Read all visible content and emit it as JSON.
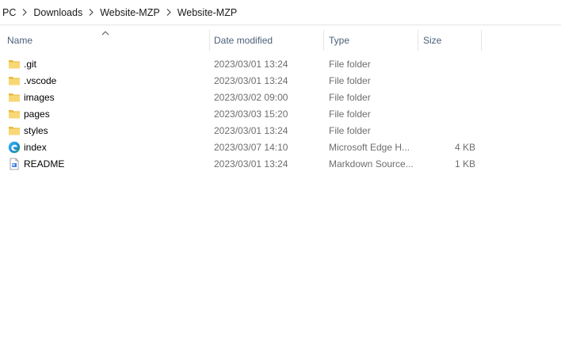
{
  "breadcrumb": [
    "PC",
    "Downloads",
    "Website-MZP",
    "Website-MZP"
  ],
  "columns": {
    "name": "Name",
    "date_modified": "Date modified",
    "type": "Type",
    "size": "Size"
  },
  "files": [
    {
      "name": ".git",
      "date": "2023/03/01 13:24",
      "type": "File folder",
      "size": "",
      "icon": "folder-icon"
    },
    {
      "name": ".vscode",
      "date": "2023/03/01 13:24",
      "type": "File folder",
      "size": "",
      "icon": "folder-icon"
    },
    {
      "name": "images",
      "date": "2023/03/02 09:00",
      "type": "File folder",
      "size": "",
      "icon": "folder-icon"
    },
    {
      "name": "pages",
      "date": "2023/03/03 15:20",
      "type": "File folder",
      "size": "",
      "icon": "folder-icon"
    },
    {
      "name": "styles",
      "date": "2023/03/01 13:24",
      "type": "File folder",
      "size": "",
      "icon": "folder-icon"
    },
    {
      "name": "index",
      "date": "2023/03/07 14:10",
      "type": "Microsoft Edge H...",
      "size": "4 KB",
      "icon": "edge-html-icon"
    },
    {
      "name": "README",
      "date": "2023/03/01 13:24",
      "type": "Markdown Source...",
      "size": "1 KB",
      "icon": "markdown-file-icon"
    }
  ],
  "colors": {
    "folder": "#f8d775",
    "folder_dark": "#e8b93f",
    "header_text": "#4c607a",
    "meta_text": "#6d6d6d",
    "divider": "#e5e5e5"
  }
}
